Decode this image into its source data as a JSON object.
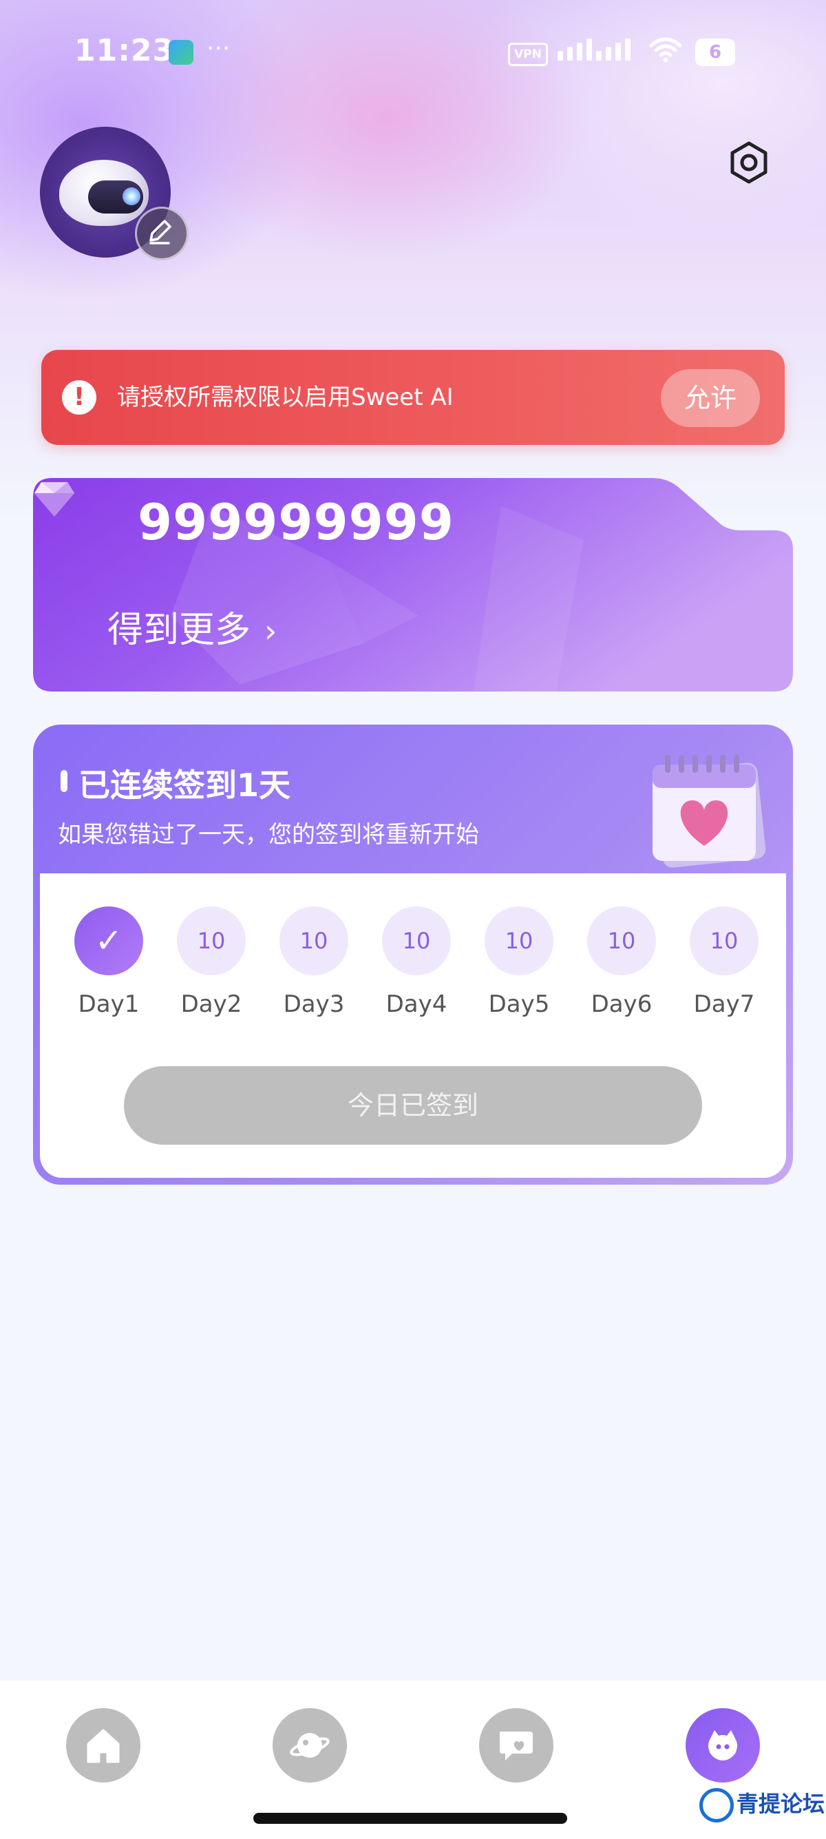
{
  "status_bar": {
    "time": "11:23",
    "dots": "···",
    "vpn": "VPN",
    "battery": "6"
  },
  "profile": {
    "avatar": "robot-avatar",
    "edit_icon": "pencil-icon",
    "settings_icon": "gear-icon"
  },
  "permission_banner": {
    "text": "请授权所需权限以启用Sweet AI",
    "allow_label": "允许",
    "color": "#e7474c"
  },
  "gems": {
    "balance": "999999999",
    "get_more_label": "得到更多",
    "get_more_chevron": "›"
  },
  "checkin": {
    "title": "已连续签到1天",
    "subtitle": "如果您错过了一天，您的签到将重新开始",
    "days": [
      {
        "label": "Day1",
        "reward": "",
        "done": true
      },
      {
        "label": "Day2",
        "reward": "10",
        "done": false
      },
      {
        "label": "Day3",
        "reward": "10",
        "done": false
      },
      {
        "label": "Day4",
        "reward": "10",
        "done": false
      },
      {
        "label": "Day5",
        "reward": "10",
        "done": false
      },
      {
        "label": "Day6",
        "reward": "10",
        "done": false
      },
      {
        "label": "Day7",
        "reward": "10",
        "done": false
      }
    ],
    "check_mark": "✓",
    "button_label": "今日已签到"
  },
  "nav": {
    "items": [
      "home-icon",
      "planet-icon",
      "chat-heart-icon",
      "profile-face-icon"
    ],
    "active_index": 3
  },
  "watermark": "青提论坛"
}
